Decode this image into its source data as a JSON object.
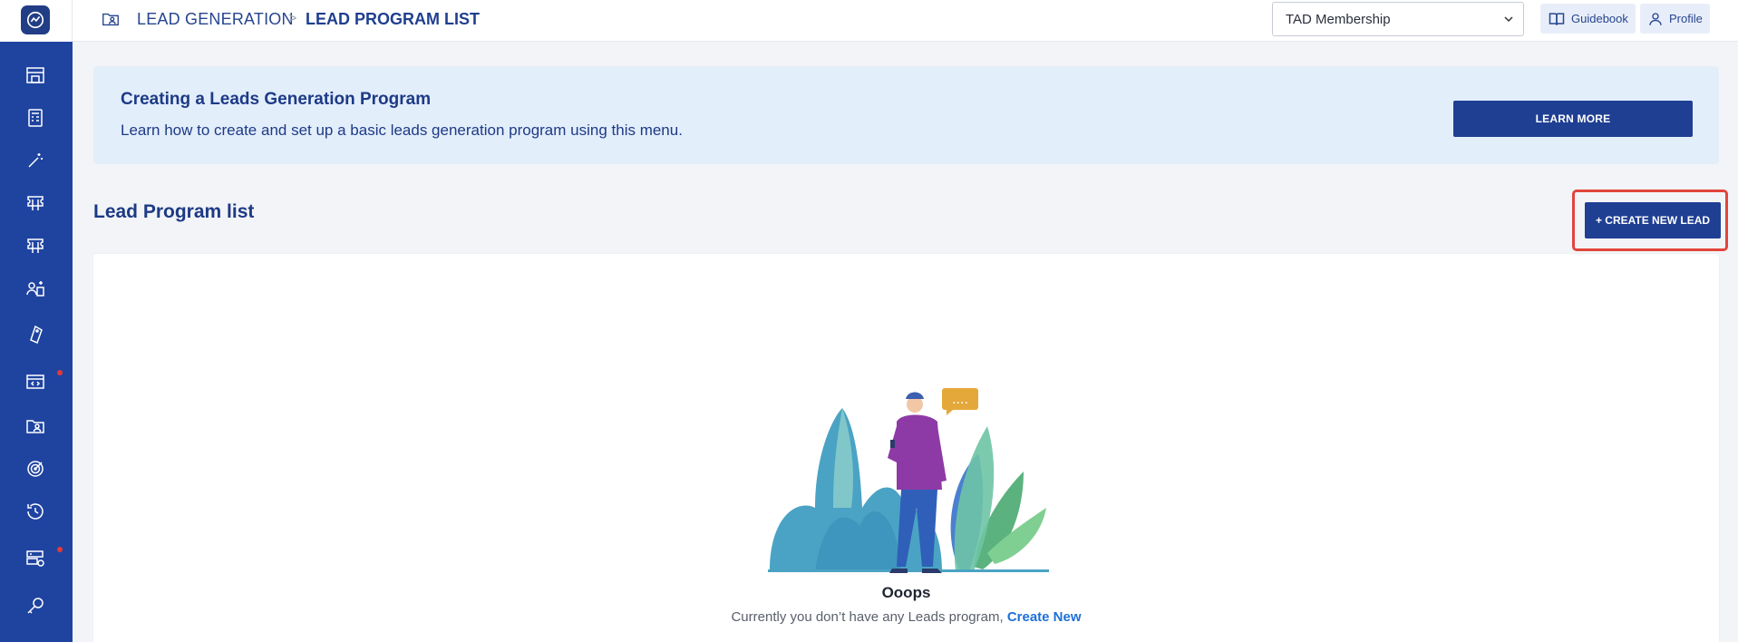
{
  "breadcrumb": {
    "section": "LEAD GENERATION",
    "separator": ">",
    "current": "LEAD PROGRAM LIST"
  },
  "header": {
    "membership_select": "TAD Membership",
    "guidebook_label": "Guidebook",
    "profile_label": "Profile"
  },
  "sidebar": {
    "items": [
      {
        "icon": "store-icon"
      },
      {
        "icon": "calculator-icon"
      },
      {
        "icon": "magic-wand-icon"
      },
      {
        "icon": "ticket-icon"
      },
      {
        "icon": "ticket-alt-icon"
      },
      {
        "icon": "user-board-icon"
      },
      {
        "icon": "tag-icon"
      },
      {
        "icon": "code-window-icon",
        "badge": true
      },
      {
        "icon": "folder-user-icon"
      },
      {
        "icon": "target-icon"
      },
      {
        "icon": "history-icon"
      },
      {
        "icon": "server-settings-icon",
        "badge": true
      },
      {
        "icon": "key-icon"
      }
    ]
  },
  "banner": {
    "title": "Creating a Leads Generation Program",
    "description": "Learn how to create and set up a basic leads generation program using this menu.",
    "button_label": "LEARN MORE"
  },
  "list": {
    "title": "Lead Program list",
    "create_button_label": "+ CREATE NEW LEAD"
  },
  "empty_state": {
    "title": "Ooops",
    "text": "Currently you don’t have any Leads program, ",
    "link_label": "Create New",
    "speech_bubble": "...."
  },
  "colors": {
    "primary": "#1f3f93",
    "sidebar": "#1f44a0",
    "highlight": "#e2453c",
    "link": "#1e6fd9"
  }
}
